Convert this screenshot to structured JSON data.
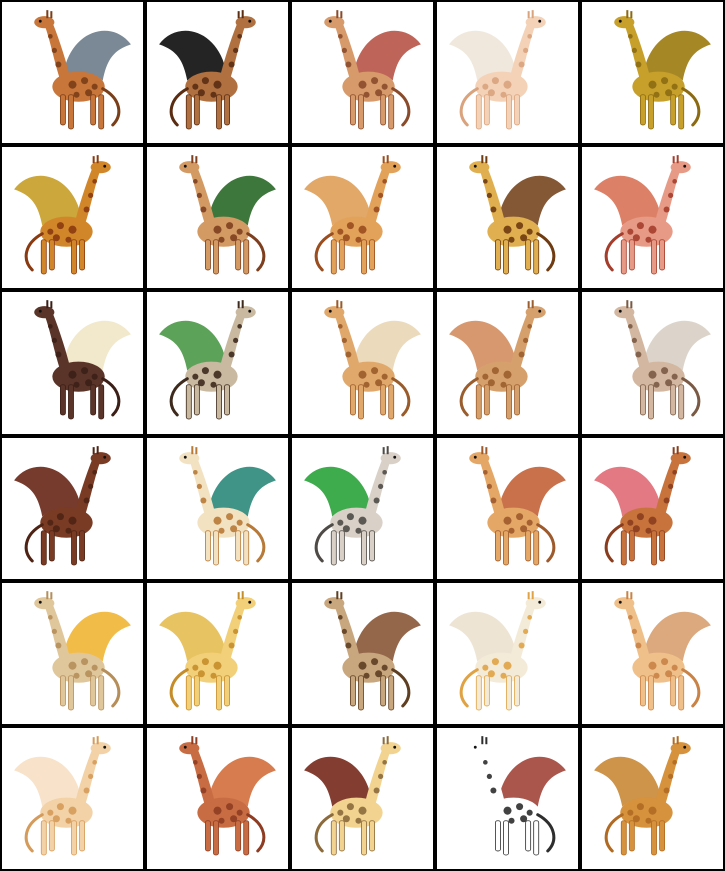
{
  "grid": {
    "rows": 6,
    "cols": 5,
    "tiles": [
      {
        "subject": "giraffe-dragon",
        "body": "#C8763A",
        "spot": "#7A3E18",
        "wing": "#6F7F8C"
      },
      {
        "subject": "giraffe-dragon",
        "body": "#B07040",
        "spot": "#5A2C12",
        "wing": "#111111"
      },
      {
        "subject": "giraffe-dragon",
        "body": "#D79A6A",
        "spot": "#8A4B2B",
        "wing": "#B8574A"
      },
      {
        "subject": "giraffe-dragon",
        "body": "#F3D2B8",
        "spot": "#D9A37E",
        "wing": "#EFE6DA"
      },
      {
        "subject": "giraffe-dragon",
        "body": "#C7A02B",
        "spot": "#8C6A12",
        "wing": "#9E7D14"
      },
      {
        "subject": "giraffe-dragon",
        "body": "#D2862A",
        "spot": "#8A3A10",
        "wing": "#C7A02B"
      },
      {
        "subject": "giraffe-dragon",
        "body": "#D39A64",
        "spot": "#7E3F1E",
        "wing": "#2E6B2A"
      },
      {
        "subject": "giraffe-dragon",
        "body": "#E3A25A",
        "spot": "#9A4D1E",
        "wing": "#E0A15B"
      },
      {
        "subject": "giraffe-dragon",
        "body": "#E0B050",
        "spot": "#6F3B10",
        "wing": "#7A4A24"
      },
      {
        "subject": "giraffe-dragon",
        "body": "#E79A86",
        "spot": "#A53D2C",
        "wing": "#D9765A"
      },
      {
        "subject": "giraffe-dragon",
        "body": "#5A3428",
        "spot": "#3B1F16",
        "wing": "#F1E6C8"
      },
      {
        "subject": "giraffe-dragon",
        "body": "#C9B9A0",
        "spot": "#3E2A1D",
        "wing": "#4E9A4A"
      },
      {
        "subject": "giraffe-dragon",
        "body": "#E1A86C",
        "spot": "#9A5B2A",
        "wing": "#E9D7B5"
      },
      {
        "subject": "giraffe-dragon",
        "body": "#D6A06C",
        "spot": "#9A5E2E",
        "wing": "#D48F63"
      },
      {
        "subject": "giraffe-dragon",
        "body": "#D4B7A0",
        "spot": "#7A5A44",
        "wing": "#D9D0C5"
      },
      {
        "subject": "giraffe-dragon",
        "body": "#7A3B24",
        "spot": "#4E2314",
        "wing": "#6A2A1A"
      },
      {
        "subject": "giraffe-dragon",
        "body": "#F3E2C2",
        "spot": "#B77A38",
        "wing": "#2F8B7D"
      },
      {
        "subject": "giraffe-dragon",
        "body": "#D9D0C7",
        "spot": "#4E4A46",
        "wing": "#2EA43E"
      },
      {
        "subject": "giraffe-dragon",
        "body": "#E5A766",
        "spot": "#9D5A2C",
        "wing": "#C4653C"
      },
      {
        "subject": "giraffe-dragon",
        "body": "#C8733C",
        "spot": "#8A3D1E",
        "wing": "#E06E78"
      },
      {
        "subject": "giraffe-dragon",
        "body": "#E0C79B",
        "spot": "#B58E5A",
        "wing": "#F1B63A"
      },
      {
        "subject": "giraffe-dragon",
        "body": "#F2D07A",
        "spot": "#C58D2A",
        "wing": "#E6BE55"
      },
      {
        "subject": "giraffe-dragon",
        "body": "#C9A77E",
        "spot": "#5E3F22",
        "wing": "#8B5A3C"
      },
      {
        "subject": "giraffe-dragon",
        "body": "#F4EAD8",
        "spot": "#E0A344",
        "wing": "#EDE2D0"
      },
      {
        "subject": "giraffe-dragon",
        "body": "#F0C08A",
        "spot": "#C98346",
        "wing": "#D9A273"
      },
      {
        "subject": "giraffe-dragon",
        "body": "#F2D2A6",
        "spot": "#D59B5A",
        "wing": "#F7E0C4"
      },
      {
        "subject": "giraffe-dragon",
        "body": "#C86D43",
        "spot": "#8E3C22",
        "wing": "#D4713F"
      },
      {
        "subject": "giraffe-dragon",
        "body": "#F2D38F",
        "spot": "#8B6A3C",
        "wing": "#7A2E20"
      },
      {
        "subject": "giraffe-dragon",
        "body": "#FFFFFF",
        "spot": "#2E2E2E",
        "wing": "#A4483E"
      },
      {
        "subject": "giraffe-dragon",
        "body": "#D6923C",
        "spot": "#B16A22",
        "wing": "#C98B3B"
      }
    ]
  }
}
